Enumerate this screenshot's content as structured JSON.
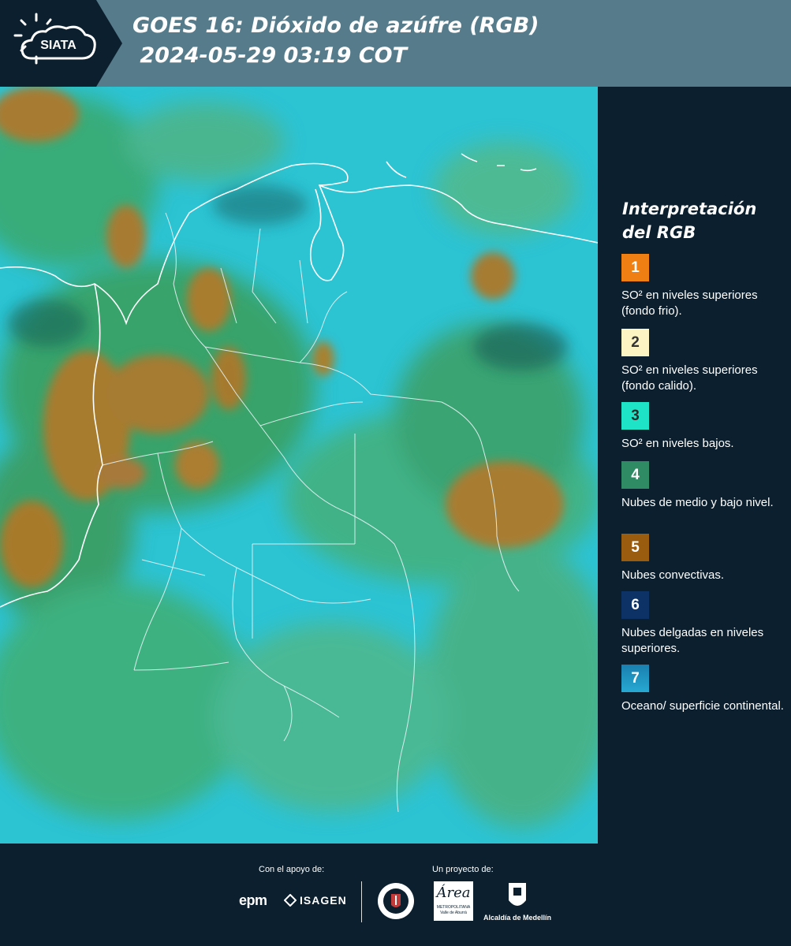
{
  "header": {
    "logo_text": "SIATA",
    "title_line1": "GOES 16: Dióxido de azúfre (RGB)",
    "title_line2": " 2024-05-29 03:19 COT"
  },
  "legend": {
    "title_line1": "Interpretación",
    "title_line2": "del RGB",
    "items": [
      {
        "num": "1",
        "color": "#f07f13",
        "text": "SO² en niveles superiores (fondo frio)."
      },
      {
        "num": "2",
        "color": "#fdf4c4",
        "text": "SO² en niveles superiores (fondo calido)."
      },
      {
        "num": "3",
        "color": "#1fe3c6",
        "text": "SO² en niveles bajos."
      },
      {
        "num": "4",
        "color": "#2e8b64",
        "text": "Nubes de medio y bajo nivel."
      },
      {
        "num": "5",
        "color": "#9a5d10",
        "text": "Nubes convectivas."
      },
      {
        "num": "6",
        "color": "#0d3366",
        "text": "Nubes delgadas en niveles superiores."
      },
      {
        "num": "7",
        "color": "#1a8fbf",
        "text": "Oceano/ superficie continental."
      }
    ]
  },
  "footer": {
    "support_label": "Con el apoyo de:",
    "project_label": "Un proyecto de:",
    "sponsors": [
      "epm",
      "ISAGEN"
    ],
    "partners": [
      "METROPOLITANA Valle de Aburrá",
      "Alcaldía de Medellín"
    ],
    "area_logo_text": "Área"
  },
  "colors": {
    "header_bg": "#567c8c",
    "panel_bg": "#0b1f2e",
    "ocean": "#29c6d6",
    "land_green": "#2f9a4c",
    "convective": "#a77a2c"
  }
}
